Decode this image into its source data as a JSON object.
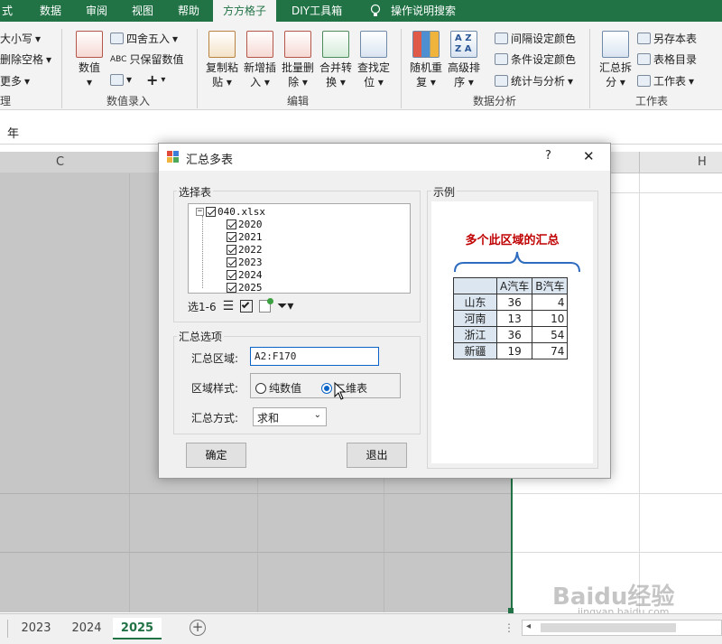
{
  "ribbon_tabs": [
    "式",
    "数据",
    "审阅",
    "视图",
    "帮助",
    "方方格子",
    "DIY工具箱",
    "操作说明搜索"
  ],
  "active_tab": "方方格子",
  "ribbon": {
    "left_items": [
      "大小写",
      "删除空格",
      "更多"
    ],
    "left_group": "理",
    "numeric_entry": {
      "big": "数值",
      "round": "四舍五入",
      "keep_numeric": "只保留数值",
      "plus": "+",
      "group": "数值录入"
    },
    "edit": {
      "buttons": [
        {
          "l1": "复制粘",
          "l2": "贴"
        },
        {
          "l1": "新增插",
          "l2": "入"
        },
        {
          "l1": "批量删",
          "l2": "除"
        },
        {
          "l1": "合并转",
          "l2": "换"
        },
        {
          "l1": "查找定",
          "l2": "位"
        }
      ],
      "group": "编辑"
    },
    "analysis": {
      "buttons": [
        {
          "l1": "随机重",
          "l2": "复"
        },
        {
          "l1": "高级排",
          "l2": "序"
        }
      ],
      "small": [
        "间隔设定颜色",
        "条件设定颜色",
        "统计与分析"
      ],
      "group": "数据分析"
    },
    "worksheet": {
      "big": {
        "l1": "汇总拆",
        "l2": "分"
      },
      "small": [
        "另存本表",
        "表格目录",
        "工作表"
      ],
      "group": "工作表"
    }
  },
  "formula_bar": {
    "value": "年"
  },
  "columns": [
    "C",
    "H"
  ],
  "sheet_tabs": [
    "2023",
    "2024",
    "2025"
  ],
  "active_sheet": "2025",
  "dialog": {
    "title": "汇总多表",
    "help": "?",
    "close": "✕",
    "select_legend": "选择表",
    "file": "040.xlsx",
    "sheets": [
      "2020",
      "2021",
      "2022",
      "2023",
      "2024",
      "2025"
    ],
    "toolbar_label": "选1-6",
    "options_legend": "汇总选项",
    "range_label": "汇总区域:",
    "range_value": "A2:F170",
    "style_label": "区域样式:",
    "style_options": [
      "纯数值",
      "二维表"
    ],
    "style_selected": "二维表",
    "method_label": "汇总方式:",
    "method_value": "求和",
    "ok": "确定",
    "exit": "退出",
    "example_legend": "示例",
    "example_title": "多个此区域的汇总",
    "example_headers": [
      "",
      "A汽车",
      "B汽车"
    ],
    "example_rows": [
      [
        "山东",
        "36",
        "4"
      ],
      [
        "河南",
        "13",
        "10"
      ],
      [
        "浙江",
        "36",
        "54"
      ],
      [
        "新疆",
        "19",
        "74"
      ]
    ]
  },
  "watermark": {
    "brand": "Baidu经验",
    "url": "jingyan.baidu.com"
  },
  "colors": {
    "excel_green": "#217346",
    "title_red": "#c00000",
    "selection_gray": "#c6c6c6"
  }
}
